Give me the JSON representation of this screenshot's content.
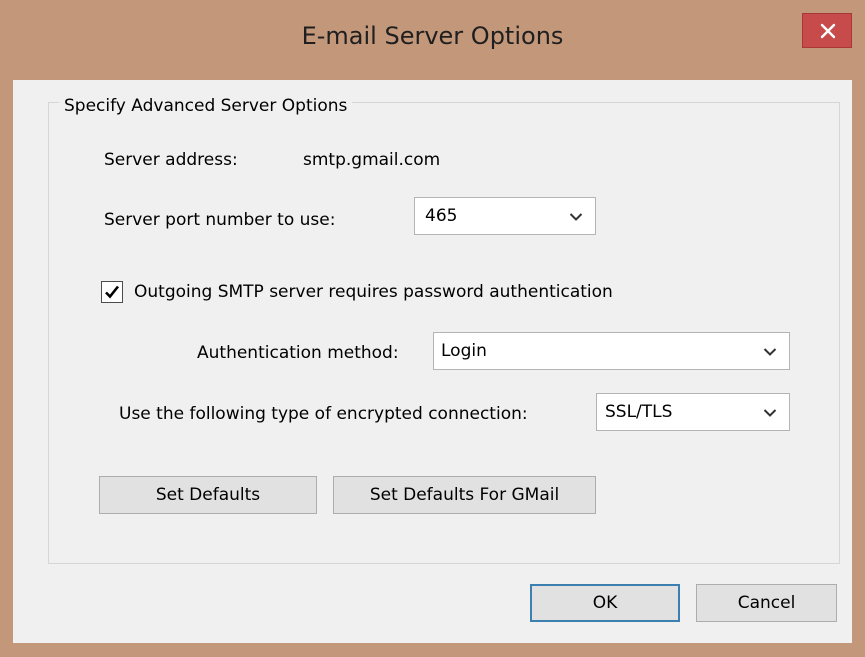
{
  "dialog": {
    "title": "E-mail Server Options",
    "close_icon": "close-icon"
  },
  "group": {
    "legend": "Specify Advanced Server Options"
  },
  "server": {
    "address_label": "Server address:",
    "address_value": "smtp.gmail.com",
    "port_label": "Server port number to use:",
    "port_value": "465"
  },
  "auth": {
    "checkbox_label": "Outgoing SMTP server requires password authentication",
    "checked": true,
    "method_label": "Authentication method:",
    "method_value": "Login",
    "encryption_label": "Use the following type of encrypted connection:",
    "encryption_value": "SSL/TLS"
  },
  "buttons": {
    "set_defaults": "Set Defaults",
    "set_defaults_gmail": "Set Defaults For GMail",
    "ok": "OK",
    "cancel": "Cancel"
  },
  "colors": {
    "frame": "#c3977a",
    "close": "#c74b4b",
    "client": "#f0f0f0",
    "default_button_border": "#3c7fb1"
  }
}
